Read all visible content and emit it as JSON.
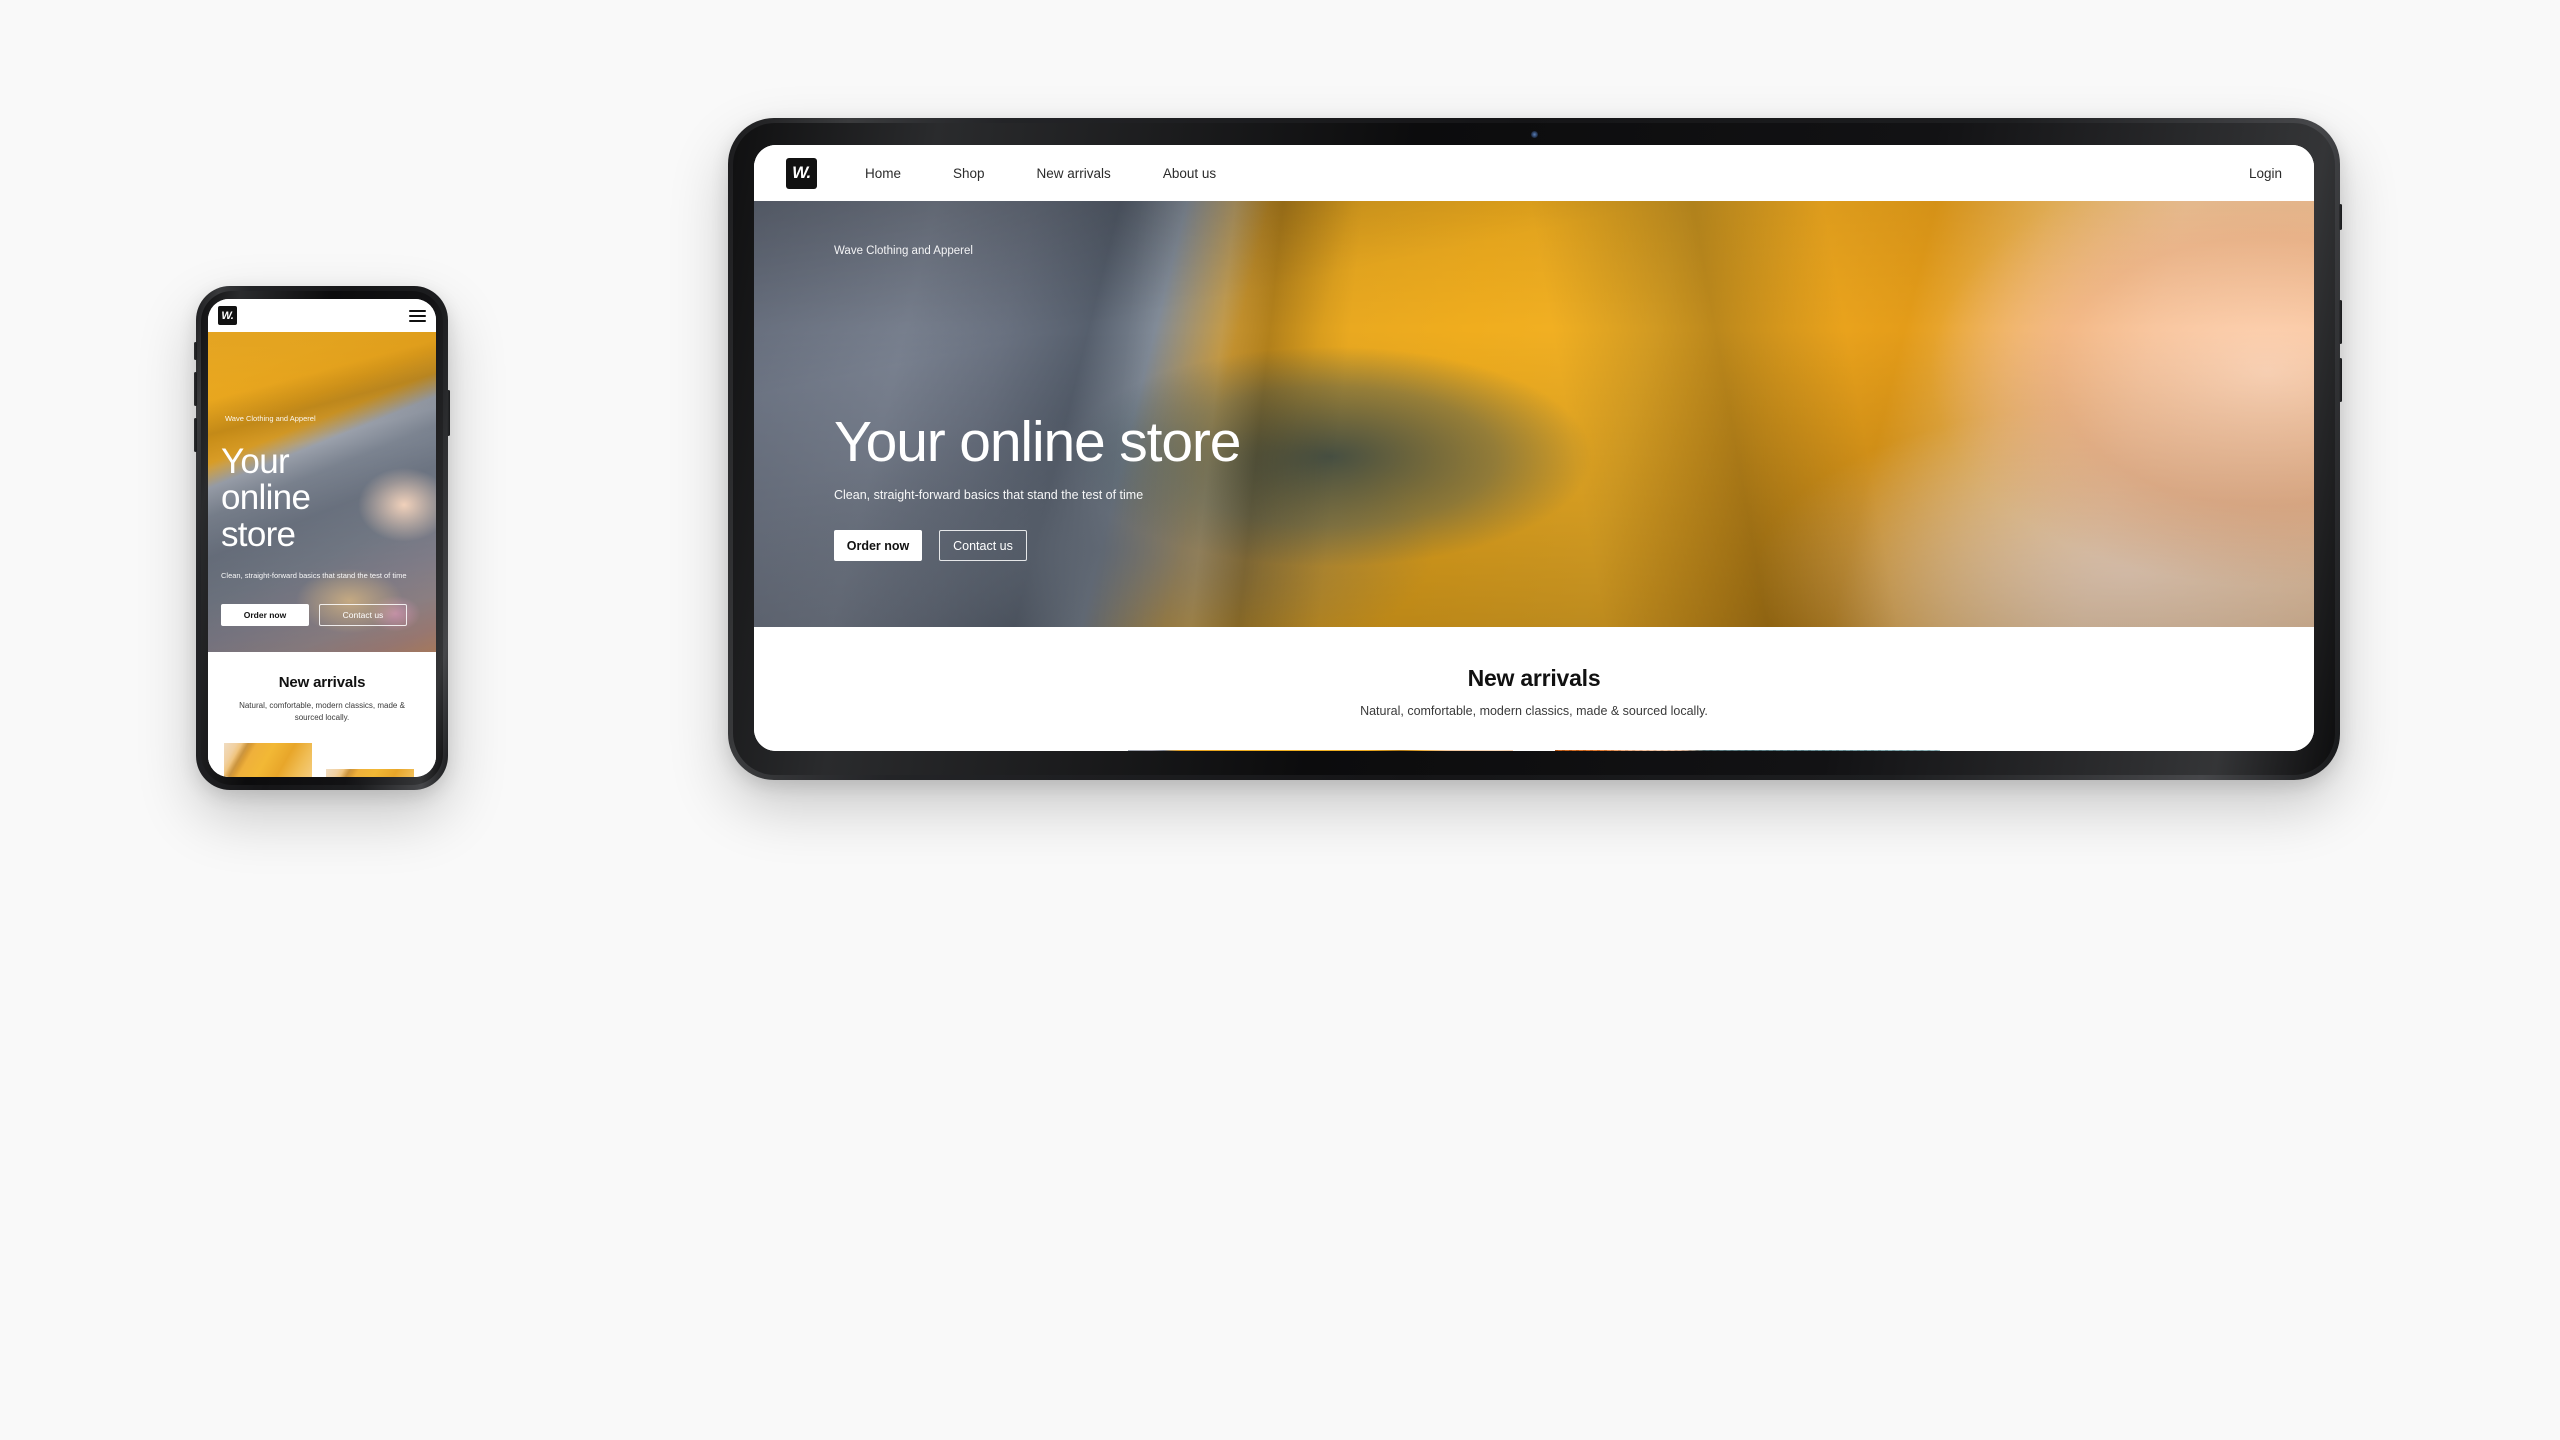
{
  "page": {
    "background_color": "#f9f9f9"
  },
  "brand": {
    "logo_text": "W.",
    "logo_bg": "#111111"
  },
  "tablet": {
    "nav": {
      "items": [
        {
          "label": "Home"
        },
        {
          "label": "Shop"
        },
        {
          "label": "New arrivals"
        },
        {
          "label": "About us"
        }
      ],
      "login_label": "Login"
    },
    "hero": {
      "eyebrow": "Wave Clothing and Apperel",
      "headline": "Your online store",
      "subline": "Clean, straight-forward basics that stand the test of time",
      "primary_cta": "Order now",
      "secondary_cta": "Contact us"
    },
    "arrivals": {
      "title": "New arrivals",
      "subtitle": "Natural, comfortable, modern classics, made & sourced locally.",
      "cards": [
        {
          "image_name": "product-photo-amber-dress"
        },
        {
          "image_name": "product-photo-teal-skirt"
        }
      ]
    }
  },
  "phone": {
    "nav": {
      "menu_icon": "hamburger-menu-icon"
    },
    "hero": {
      "eyebrow": "Wave Clothing and Apperel",
      "headline": "Your online store",
      "subline": "Clean, straight-forward basics that stand the test of time",
      "primary_cta": "Order now",
      "secondary_cta": "Contact us"
    },
    "arrivals": {
      "title": "New arrivals",
      "subtitle": "Natural, comfortable, modern classics, made & sourced locally.",
      "cards": [
        {
          "image_name": "product-photo-amber-1"
        },
        {
          "image_name": "product-photo-amber-2"
        }
      ]
    }
  }
}
